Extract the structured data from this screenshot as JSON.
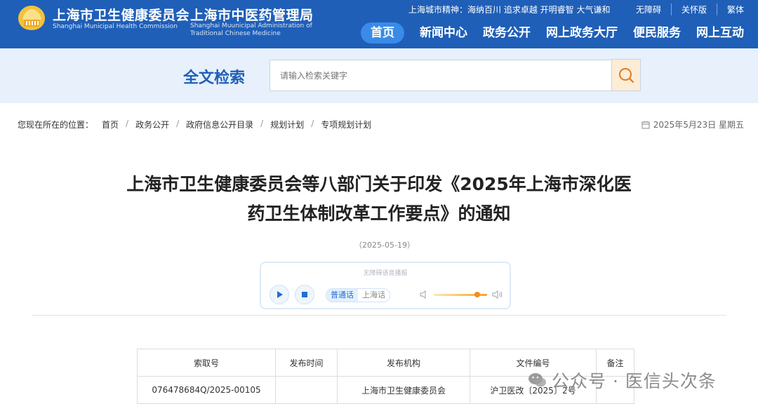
{
  "header": {
    "org1_cn": "上海市卫生健康委员会",
    "org1_en": "Shanghai Municipal Health Commission",
    "org2_cn": "上海市中医药管理局",
    "org2_en": "Shanghai Muunicipal Administration of Traditional Chinese Medicine",
    "spirit": "上海城市精神：海纳百川 追求卓越 开明睿智 大气谦和",
    "util_links": [
      "无障碍",
      "关怀版",
      "繁体"
    ],
    "nav": [
      "首页",
      "新闻中心",
      "政务公开",
      "网上政务大厅",
      "便民服务",
      "网上互动"
    ],
    "active_nav": "首页",
    "brand_color": "#1f5fb8"
  },
  "search": {
    "title": "全文检索",
    "placeholder": "请输入检索关键字",
    "button_icon": "search-icon"
  },
  "breadcrumb": {
    "prefix": "您现在所在的位置：",
    "items": [
      "首页",
      "政务公开",
      "政府信息公开目录",
      "规划计划",
      "专项规划计划"
    ],
    "date": "2025年5月23日 星期五",
    "date_icon": "calendar-icon"
  },
  "article": {
    "title_line1": "上海市卫生健康委员会等八部门关于印发《2025年上海市深化医",
    "title_line2": "药卫生体制改革工作要点》的通知",
    "pubdate": "（2025-05-19）"
  },
  "player": {
    "label": "无障碍语音播报",
    "dialects": [
      "普通话",
      "上海话"
    ],
    "active_dialect": "普通话",
    "volume": 0.82
  },
  "info_table": {
    "headers": [
      "索取号",
      "发布时间",
      "发布机构",
      "文件编号",
      "备注"
    ],
    "row": [
      "076478684Q/2025-00105",
      "",
      "上海市卫生健康委员会",
      "沪卫医改〔2025〕2号",
      ""
    ]
  },
  "watermark": "公众号 · 医信头次条"
}
